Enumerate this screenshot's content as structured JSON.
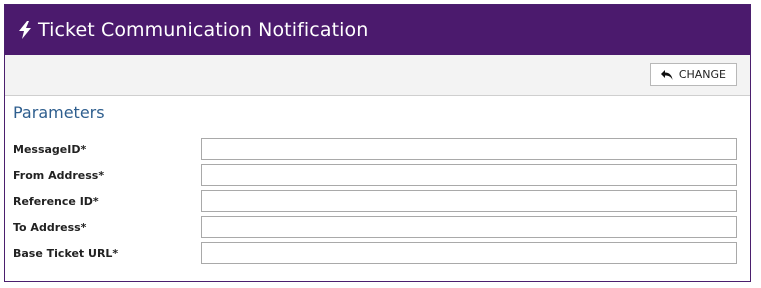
{
  "header": {
    "title": "Ticket Communication Notification",
    "icon": "lightning-bolt-icon",
    "bg": "#4b1a6d"
  },
  "toolbar": {
    "change_label": "CHANGE",
    "change_icon": "undo-arrow-icon"
  },
  "section": {
    "title": "Parameters"
  },
  "fields": [
    {
      "label": "MessageID*",
      "value": ""
    },
    {
      "label": "From Address*",
      "value": ""
    },
    {
      "label": "Reference ID*",
      "value": ""
    },
    {
      "label": "To Address*",
      "value": ""
    },
    {
      "label": "Base Ticket URL*",
      "value": ""
    }
  ]
}
